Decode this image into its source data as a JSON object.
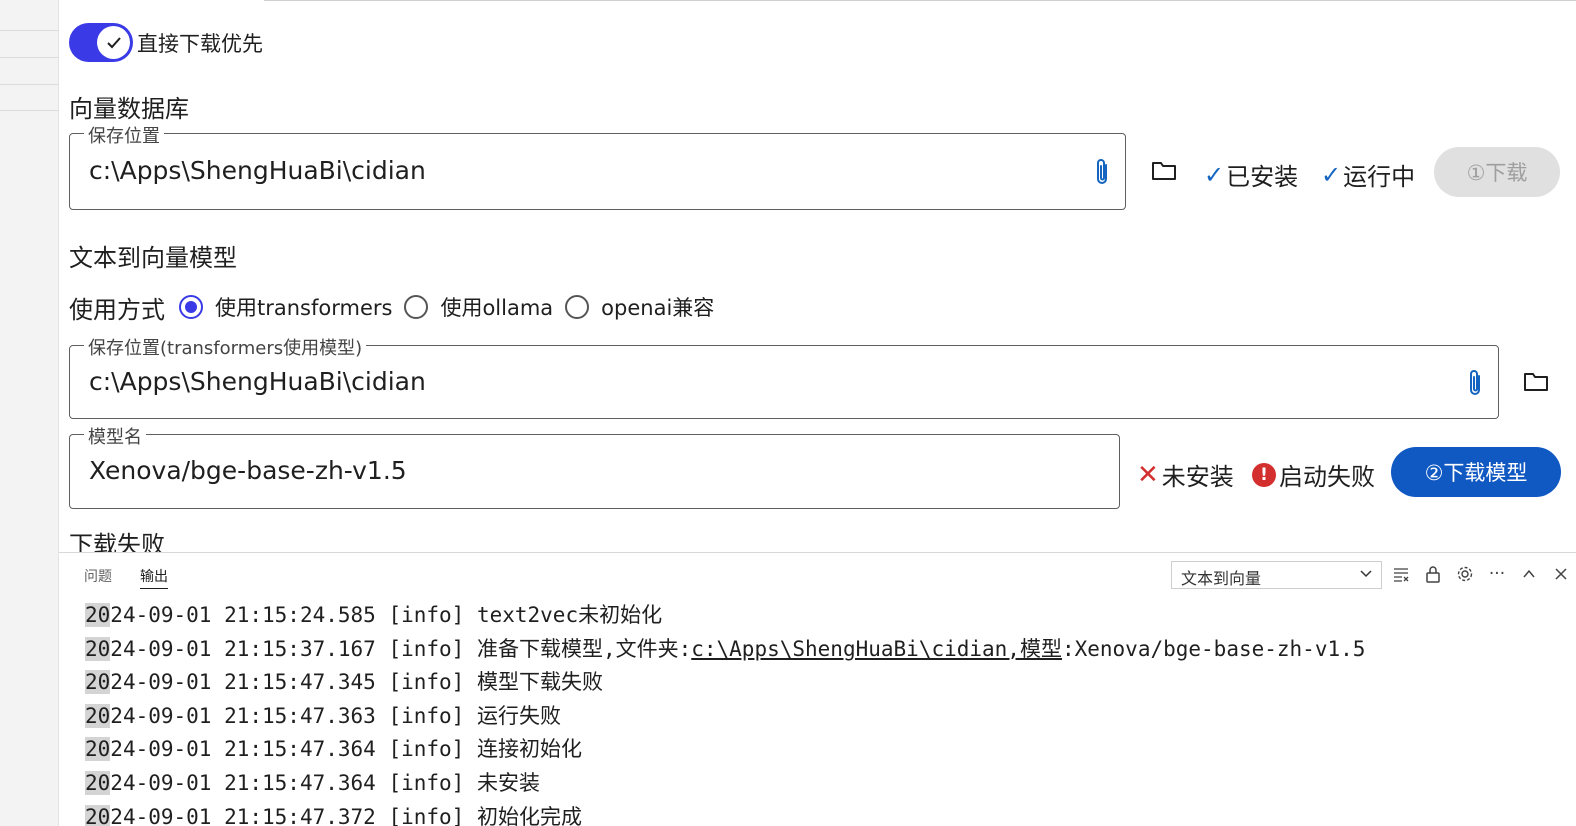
{
  "settings": {
    "toggle_label": "直接下载优先",
    "vector_db": {
      "title": "向量数据库",
      "field_label": "保存位置",
      "path": "c:\\Apps\\ShengHuaBi\\cidian",
      "status_installed": "已安装",
      "status_running": "运行中",
      "download_button": "①下载"
    },
    "text2vec": {
      "title": "文本到向量模型",
      "mode_label": "使用方式",
      "options": [
        "使用transformers",
        "使用ollama",
        "openai兼容"
      ],
      "selected_option": "使用transformers",
      "path_label": "保存位置(transformers使用模型)",
      "path": "c:\\Apps\\ShengHuaBi\\cidian",
      "model_label": "模型名",
      "model_name": "Xenova/bge-base-zh-v1.5",
      "status_not_installed": "未安装",
      "status_start_failed": "启动失败",
      "download_button": "②下载模型"
    },
    "download_status": "下载失败"
  },
  "panel": {
    "tabs": [
      "问题",
      "输出"
    ],
    "active_tab": "输出",
    "channel": "文本到向量",
    "log": [
      {
        "year": "20",
        "rest": "24-09-01 21:15:24.585 [info] text2vec未初始化",
        "tail": "",
        "link": "",
        "after": ""
      },
      {
        "year": "20",
        "rest": "24-09-01 21:15:37.167 [info] 准备下载模型,文件夹:",
        "link": "c:\\Apps\\ShengHuaBi\\cidian,模型",
        "after": ":Xenova/bge-base-zh-v1.5"
      },
      {
        "year": "20",
        "rest": "24-09-01 21:15:47.345 [info] 模型下载失败",
        "link": "",
        "after": ""
      },
      {
        "year": "20",
        "rest": "24-09-01 21:15:47.363 [info] 运行失败",
        "link": "",
        "after": ""
      },
      {
        "year": "20",
        "rest": "24-09-01 21:15:47.364 [info] 连接初始化",
        "link": "",
        "after": ""
      },
      {
        "year": "20",
        "rest": "24-09-01 21:15:47.364 [info] 未安装",
        "link": "",
        "after": ""
      },
      {
        "year": "20",
        "rest": "24-09-01 21:15:47.372 [info] 初始化完成",
        "link": "",
        "after": ""
      }
    ]
  },
  "icons": {
    "check": "✓",
    "cross": "✕",
    "error": "!",
    "more": "···",
    "chevron_up": "︿",
    "close": "✕"
  },
  "colors": {
    "accent": "#3a3ae6",
    "primary_button": "#1058c2",
    "check": "#1565c0",
    "error": "#d32f2f"
  }
}
